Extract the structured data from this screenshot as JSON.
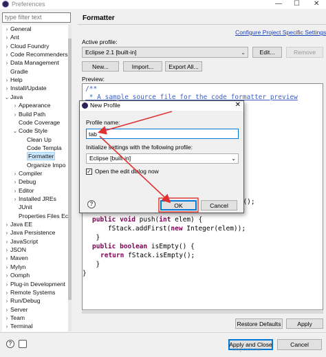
{
  "window": {
    "title": "Preferences",
    "controls": {
      "minimize": "—",
      "maximize": "☐",
      "close": "✕"
    }
  },
  "filter": {
    "placeholder": "type filter text"
  },
  "tree": [
    {
      "label": "General",
      "arrow": "›"
    },
    {
      "label": "Ant",
      "arrow": "›"
    },
    {
      "label": "Cloud Foundry",
      "arrow": "›"
    },
    {
      "label": "Code Recommenders",
      "arrow": "›"
    },
    {
      "label": "Data Management",
      "arrow": "›"
    },
    {
      "label": "Gradle",
      "arrow": ""
    },
    {
      "label": "Help",
      "arrow": "›"
    },
    {
      "label": "Install/Update",
      "arrow": "›"
    },
    {
      "label": "Java",
      "arrow": "⌄"
    },
    {
      "label": "Appearance",
      "arrow": "›"
    },
    {
      "label": "Build Path",
      "arrow": "›"
    },
    {
      "label": "Code Coverage",
      "arrow": ""
    },
    {
      "label": "Code Style",
      "arrow": "⌄"
    },
    {
      "label": "Clean Up",
      "arrow": ""
    },
    {
      "label": "Code Templa",
      "arrow": ""
    },
    {
      "label": "Formatter",
      "arrow": ""
    },
    {
      "label": "Organize Impo",
      "arrow": ""
    },
    {
      "label": "Compiler",
      "arrow": "›"
    },
    {
      "label": "Debug",
      "arrow": "›"
    },
    {
      "label": "Editor",
      "arrow": "›"
    },
    {
      "label": "Installed JREs",
      "arrow": "›"
    },
    {
      "label": "JUnit",
      "arrow": ""
    },
    {
      "label": "Properties Files Ec",
      "arrow": ""
    },
    {
      "label": "Java EE",
      "arrow": "›"
    },
    {
      "label": "Java Persistence",
      "arrow": "›"
    },
    {
      "label": "JavaScript",
      "arrow": "›"
    },
    {
      "label": "JSON",
      "arrow": "›"
    },
    {
      "label": "Maven",
      "arrow": "›"
    },
    {
      "label": "Mylyn",
      "arrow": "›"
    },
    {
      "label": "Oomph",
      "arrow": "›"
    },
    {
      "label": "Plug-in Development",
      "arrow": "›"
    },
    {
      "label": "Remote Systems",
      "arrow": "›"
    },
    {
      "label": "Run/Debug",
      "arrow": "›"
    },
    {
      "label": "Server",
      "arrow": "›"
    },
    {
      "label": "Team",
      "arrow": "›"
    },
    {
      "label": "Terminal",
      "arrow": "›"
    }
  ],
  "page": {
    "title": "Formatter",
    "configure_link": "Configure Project Specific Settings...",
    "active_profile_label": "Active profile:",
    "active_profile_value": "Eclipse 2.1 [built-in]",
    "edit_button": "Edit...",
    "remove_button": "Remove",
    "new_button": "New...",
    "import_button": "Import...",
    "export_button": "Export All...",
    "preview_label": "Preview:",
    "restore_button": "Restore Defaults",
    "apply_button": "Apply"
  },
  "preview_code": {
    "l1": "/**",
    "l2": " * A sample source file for the code formatter preview",
    "l3": "ue();",
    "l4_kw1": "public",
    "l4_kw2": "void",
    "l4_a": " push(",
    "l4_kw3": "int",
    "l4_b": " elem) {",
    "l5_a": "    fStack.addFirst(",
    "l5_kw": "new",
    "l5_b": " Integer(elem));",
    "l6": "  }",
    "l7_kw1": "public",
    "l7_kw2": "boolean",
    "l7_a": " isEmpty() {",
    "l8_kw": "return",
    "l8_a": " fStack.isEmpty();",
    "l9": "  }",
    "l10": "}"
  },
  "footer": {
    "apply_close_button": "Apply and Close",
    "cancel_button": "Cancel",
    "help_icon_glyph": "?"
  },
  "dialog": {
    "title": "New Profile",
    "close_glyph": "✕",
    "profile_name_label": "Profile name:",
    "profile_name_value": "tab",
    "init_label": "Initialize settings with the following profile:",
    "init_value": "Eclipse [built-in]",
    "open_edit_label": "Open the edit dialog now",
    "open_edit_checked": "✓",
    "ok_button": "OK",
    "cancel_button": "Cancel",
    "help_icon_glyph": "?"
  },
  "colors": {
    "annotation_arrow": "#e03030",
    "link": "#1a3fb5",
    "keyword": "#7f0055",
    "comment": "#3f5fbf"
  }
}
